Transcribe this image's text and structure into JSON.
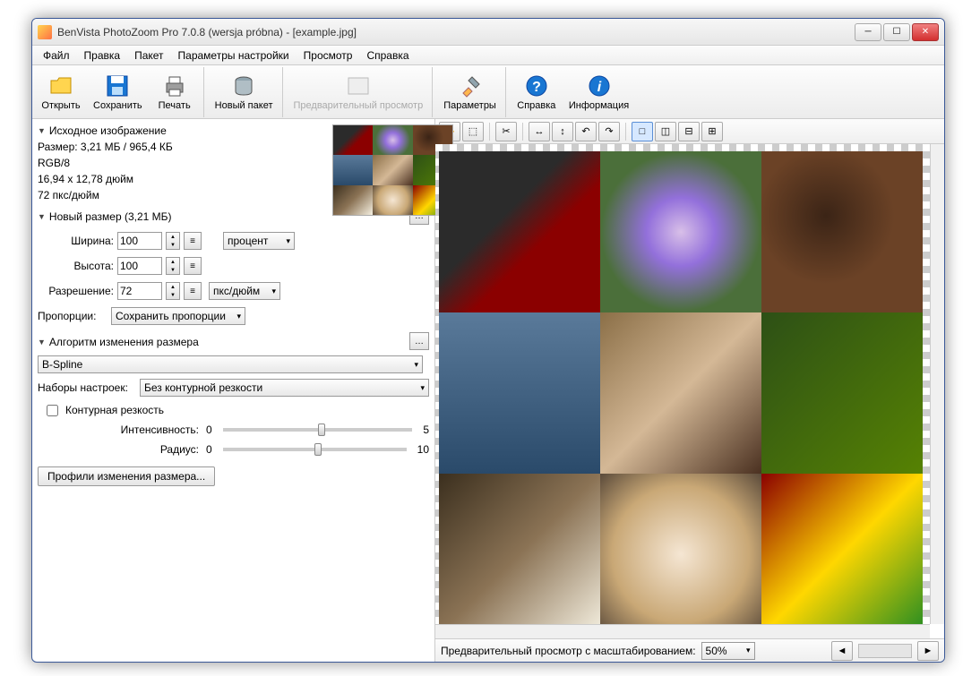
{
  "titlebar": {
    "title": "BenVista PhotoZoom Pro 7.0.8 (wersja próbna) - [example.jpg]"
  },
  "menu": {
    "file": "Файл",
    "edit": "Правка",
    "batch": "Пакет",
    "options": "Параметры настройки",
    "view": "Просмотр",
    "help": "Справка"
  },
  "toolbar": {
    "open": "Открыть",
    "save": "Сохранить",
    "print": "Печать",
    "newbatch": "Новый пакет",
    "preview": "Предварительный просмотр",
    "params": "Параметры",
    "help": "Справка",
    "info": "Информация"
  },
  "source": {
    "header": "Исходное изображение",
    "sizeLine": "Размер: 3,21 МБ / 965,4 КБ",
    "colorMode": "RGB/8",
    "dims": "16,94 x 12,78 дюйм",
    "dpi": "72 пкс/дюйм"
  },
  "newsize": {
    "header": "Новый размер (3,21 МБ)",
    "widthLabel": "Ширина:",
    "widthValue": "100",
    "heightLabel": "Высота:",
    "heightValue": "100",
    "unit": "процент",
    "resLabel": "Разрешение:",
    "resValue": "72",
    "resUnit": "пкс/дюйм",
    "propLabel": "Пропорции:",
    "propValue": "Сохранить пропорции"
  },
  "algo": {
    "header": "Алгоритм изменения размера",
    "method": "B-Spline",
    "presetsLabel": "Наборы настроек:",
    "presetsValue": "Без контурной резкости",
    "unsharp": "Контурная резкость",
    "intensityLabel": "Интенсивность:",
    "intensityMin": "0",
    "intensityMax": "5",
    "radiusLabel": "Радиус:",
    "radiusMin": "0",
    "radiusMax": "10",
    "profilesBtn": "Профили изменения размера..."
  },
  "status": {
    "zoomLabel": "Предварительный просмотр с масштабированием:",
    "zoomValue": "50%"
  },
  "icons": {
    "open": "open-folder-icon",
    "save": "floppy-icon",
    "print": "printer-icon",
    "batch": "database-plus-icon",
    "preview": "image-icon",
    "params": "tools-icon",
    "help": "help-icon",
    "info": "info-icon"
  }
}
